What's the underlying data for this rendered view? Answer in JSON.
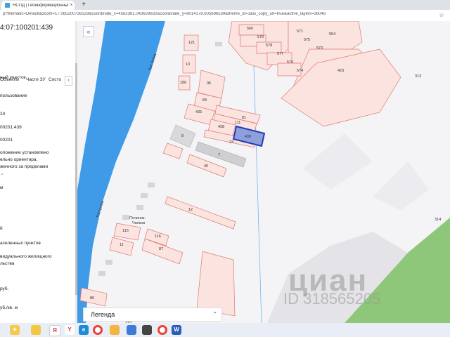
{
  "browser": {
    "tab_title": "НСПД | Геоинформационный",
    "close_glyph": "×",
    "new_tab_glyph": "+",
    "url": "p?thematic=Default&zoom=17.085200738129&coordinate_x=4562381.043629832&coordinate_y=8014178.605686539&theme_id=1&is_copy_url=true&active_layers=36048",
    "star_glyph": "☆"
  },
  "panel": {
    "cadastral_number": "4:07:100201:439",
    "tabs": [
      "Объекты",
      "Части ЗУ",
      "Состо"
    ],
    "next_glyph": "›",
    "rows": [
      {
        "text": "ный участок",
        "link": false
      },
      {
        "text": "пользование",
        "link": false
      },
      {
        "text": "24",
        "link": false
      },
      {
        "text": "00201:439",
        "link": false
      },
      {
        "text": "00201",
        "link": false
      },
      {
        "text": "оложение установлено",
        "link": false
      },
      {
        "text": "ельно ориентира,",
        "link": false
      },
      {
        "text": "женного за пределами",
        "link": false
      },
      {
        "text": "⌄",
        "link": true
      },
      {
        "text": "м",
        "link": false
      },
      {
        "text": "й",
        "link": false
      },
      {
        "text": "аселенных пунктов",
        "link": false
      },
      {
        "text": "видуального жилищного",
        "link": false
      },
      {
        "text": "льства",
        "link": false
      },
      {
        "text": "руб.",
        "link": false
      },
      {
        "text": "уб./кв. м",
        "link": false
      }
    ]
  },
  "map": {
    "collapse_glyph": "«",
    "legend_label": "Легенда",
    "legend_chevron": "⌃",
    "watermark": "циан",
    "watermark_id": "ID 318565205",
    "river_labels": [
      "Кострома",
      "Кострома"
    ],
    "village_label": [
      "Починок-",
      "Чапков"
    ],
    "parcel_labels": [
      "560",
      "576",
      "578",
      "577",
      "576",
      "574",
      "571",
      "575",
      "573",
      "554",
      "423",
      "121",
      "13",
      "186",
      "96",
      "84",
      "435",
      "438",
      "111",
      "81",
      "8",
      "439",
      "23",
      "7",
      "40",
      "12",
      "115",
      "116",
      "11",
      "87",
      "86",
      "410",
      "313",
      "314"
    ],
    "colors": {
      "parcel_stroke": "#e07a70",
      "parcel_fill": "#fbe3df",
      "selected_fill": "#8e9fdc",
      "selected_stroke": "#1f3fb5",
      "river": "#3f9be8",
      "green": "#8fc77a"
    }
  },
  "taskbar": {
    "icons": [
      "sparkle-icon",
      "files-icon",
      "yandex-icon",
      "edge-icon",
      "chrome-icon",
      "folder-icon",
      "mail-icon",
      "camera-icon",
      "chrome-alt-icon",
      "word-icon"
    ]
  }
}
